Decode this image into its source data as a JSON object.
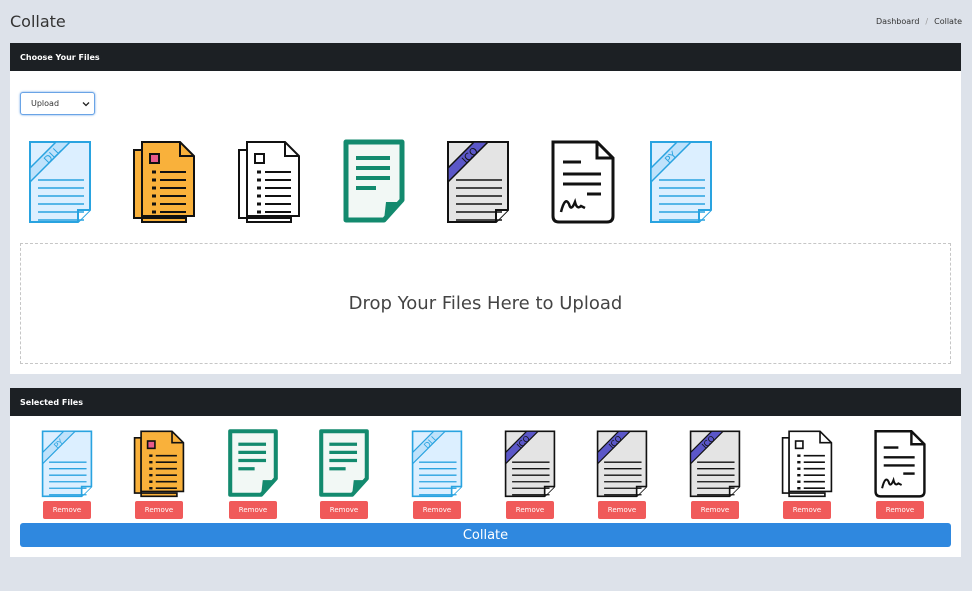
{
  "page": {
    "title": "Collate"
  },
  "breadcrumb": {
    "items": [
      "Dashboard",
      "Collate"
    ],
    "separator": "/"
  },
  "choose_section": {
    "header": "Choose Your Files",
    "select": {
      "selected": "Upload"
    },
    "file_icons": [
      "dll-file-icon",
      "docs-yellow-icon",
      "docs-outline-icon",
      "doc-green-icon",
      "ico-file-icon",
      "signed-doc-icon",
      "py-file-icon"
    ],
    "dropzone_text": "Drop Your Files Here to Upload"
  },
  "selected_section": {
    "header": "Selected Files",
    "files": [
      {
        "icon": "py-file-icon",
        "remove_label": "Remove"
      },
      {
        "icon": "docs-yellow-icon",
        "remove_label": "Remove"
      },
      {
        "icon": "doc-green-icon",
        "remove_label": "Remove"
      },
      {
        "icon": "doc-green-icon",
        "remove_label": "Remove"
      },
      {
        "icon": "dll-file-icon",
        "remove_label": "Remove"
      },
      {
        "icon": "ico-file-icon",
        "remove_label": "Remove"
      },
      {
        "icon": "ico-file-icon",
        "remove_label": "Remove"
      },
      {
        "icon": "ico-file-icon",
        "remove_label": "Remove"
      },
      {
        "icon": "docs-outline-icon",
        "remove_label": "Remove"
      },
      {
        "icon": "signed-doc-icon",
        "remove_label": "Remove"
      }
    ],
    "collate_label": "Collate"
  },
  "colors": {
    "header_bg": "#1c2024",
    "remove_red": "#f05a5a",
    "collate_blue": "#2f88df",
    "page_bg": "#dde2ea"
  }
}
